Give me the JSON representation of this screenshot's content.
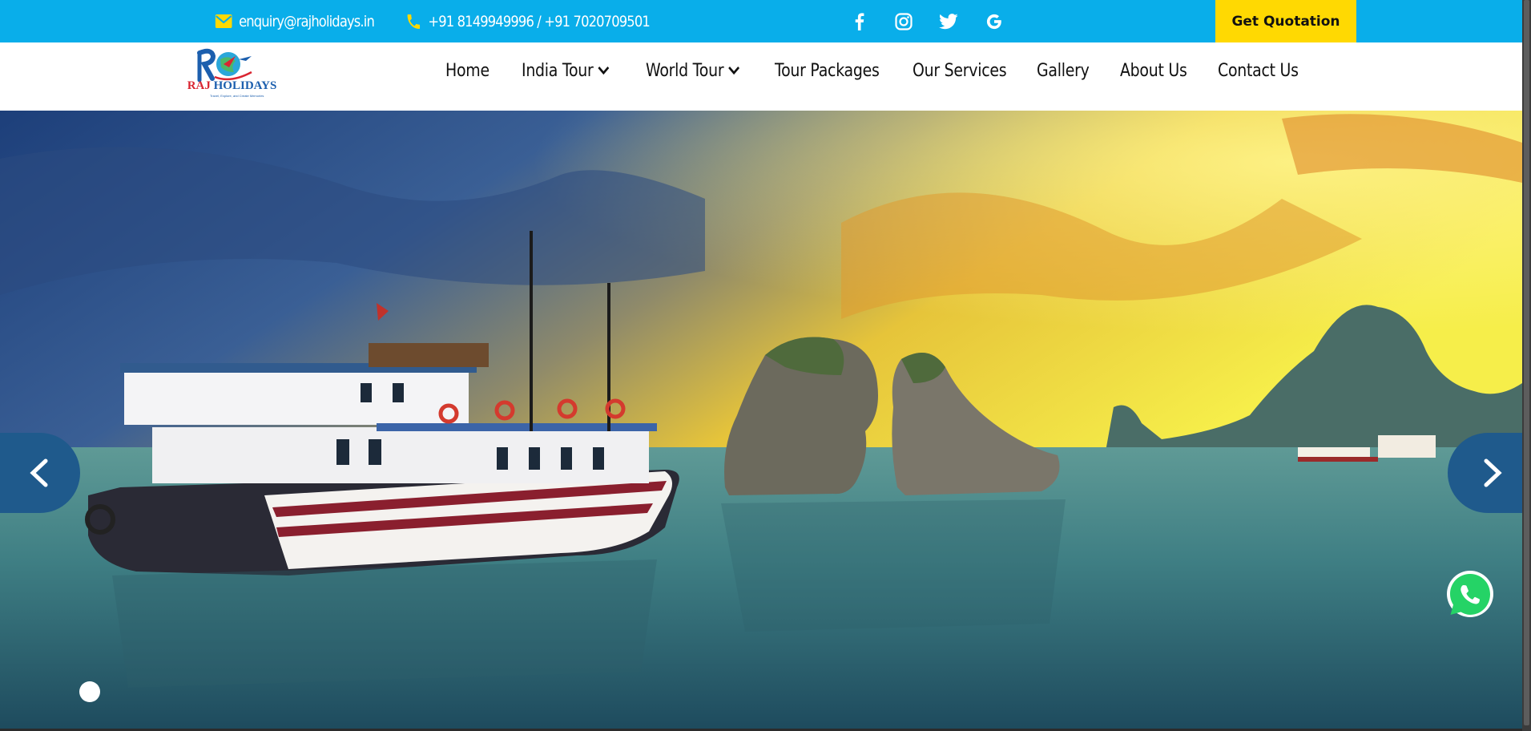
{
  "topbar": {
    "email": "enquiry@rajholidays.in",
    "phone": "+91 8149949996 / +91 7020709501",
    "social": [
      "facebook-icon",
      "instagram-icon",
      "twitter-icon",
      "google-icon"
    ],
    "quote_label": "Get Quotation",
    "bg_color": "#09aeea",
    "quote_color": "#ffd902",
    "icon_color": "#ffd902"
  },
  "logo": {
    "raj": "RAJ",
    "holidays": "HOLIDAYS",
    "tagline": "Travel, Explore, and Create Memories"
  },
  "nav": {
    "items": [
      {
        "label": "Home"
      },
      {
        "label": "India Tour",
        "dropdown": true
      },
      {
        "label": "World Tour",
        "dropdown": true
      },
      {
        "label": "Tour Packages"
      },
      {
        "label": "Our Services"
      },
      {
        "label": "Gallery"
      },
      {
        "label": "About Us"
      },
      {
        "label": "Contact Us"
      }
    ]
  },
  "hero": {
    "prev_icon": "chevron-left-icon",
    "next_icon": "chevron-right-icon",
    "slides": 1,
    "active_slide": 1,
    "arrow_color": "#1f5a8c"
  },
  "whatsapp": {
    "icon": "whatsapp-icon",
    "color": "#25d366"
  }
}
